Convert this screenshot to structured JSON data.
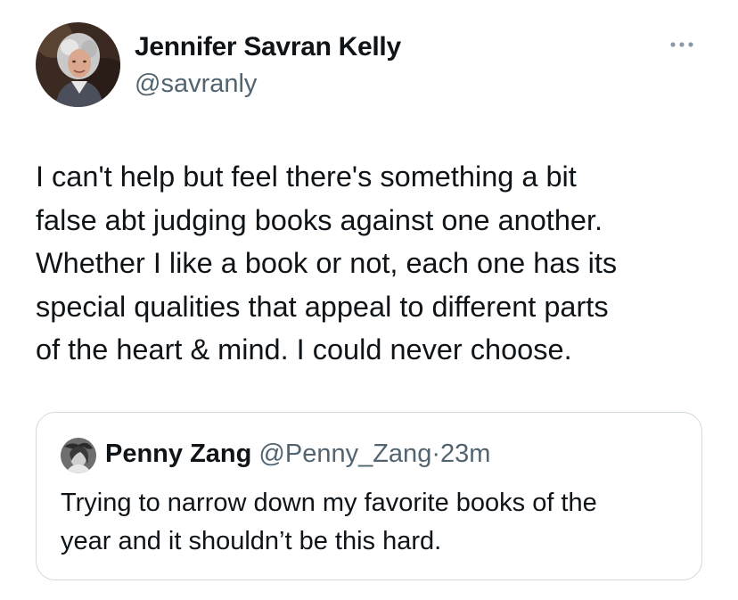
{
  "tweet": {
    "author": {
      "name": "Jennifer Savran Kelly",
      "handle": "@savranly",
      "avatar_icon": "profile-photo"
    },
    "more_icon": "more-horizontal-icon",
    "text": "I can't help but feel there's something a bit\nfalse abt judging books against one another.\nWhether I like a book or not, each one has its\nspecial qualities that appeal to different parts\nof the heart & mind. I could never choose.",
    "quoted": {
      "author_name": "Penny Zang",
      "handle": "@Penny_Zang",
      "separator": "·",
      "time": "23m",
      "text": "Trying to narrow down my favorite books of the\nyear and it shouldn’t be this hard."
    }
  },
  "colors": {
    "text_primary": "#0f1419",
    "text_secondary": "#536471",
    "border": "#cfd9de",
    "icon": "#8b98a5"
  }
}
